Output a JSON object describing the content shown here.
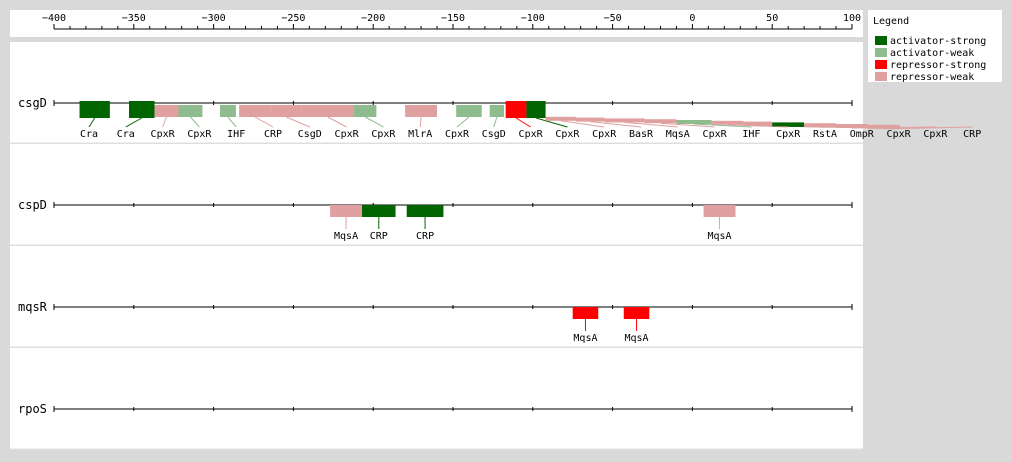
{
  "chart_data": {
    "type": "track-diagram",
    "axis": {
      "min": -400,
      "max": 100,
      "major_ticks": [
        -400,
        -350,
        -300,
        -250,
        -200,
        -150,
        -100,
        -50,
        0,
        50,
        100
      ],
      "tick_labels": [
        "−400",
        "−350",
        "−300",
        "−250",
        "−200",
        "−150",
        "−100",
        "−50",
        "0",
        "50",
        "100"
      ]
    },
    "legend": {
      "title": "Legend",
      "entries": [
        {
          "name": "activator-strong",
          "color": "#006400"
        },
        {
          "name": "activator-weak",
          "color": "#8fbc8f"
        },
        {
          "name": "repressor-strong",
          "color": "#ff0000"
        },
        {
          "name": "repressor-weak",
          "color": "#e0a0a0"
        }
      ]
    },
    "tracks": [
      {
        "gene": "csgD",
        "sites": [
          {
            "label": "Cra",
            "start": -384,
            "end": -365,
            "type": "activator-strong"
          },
          {
            "label": "Cra",
            "start": -353,
            "end": -337,
            "type": "activator-strong"
          },
          {
            "label": "CpxR",
            "start": -337,
            "end": -322,
            "type": "repressor-weak"
          },
          {
            "label": "CpxR",
            "start": -322,
            "end": -307,
            "type": "activator-weak"
          },
          {
            "label": "IHF",
            "start": -296,
            "end": -286,
            "type": "activator-weak"
          },
          {
            "label": "CRP",
            "start": -284,
            "end": -264,
            "type": "repressor-weak"
          },
          {
            "label": "CsgD",
            "start": -264,
            "end": -245,
            "type": "repressor-weak"
          },
          {
            "label": "CpxR",
            "start": -245,
            "end": -212,
            "type": "repressor-weak"
          },
          {
            "label": "CpxR",
            "start": -212,
            "end": -198,
            "type": "activator-weak"
          },
          {
            "label": "MlrA",
            "start": -180,
            "end": -160,
            "type": "repressor-weak"
          },
          {
            "label": "CpxR",
            "start": -148,
            "end": -132,
            "type": "activator-weak"
          },
          {
            "label": "CsgD",
            "start": -127,
            "end": -118,
            "type": "activator-weak"
          },
          {
            "label": "CpxR",
            "start": -117,
            "end": -104,
            "type": "repressor-strong"
          },
          {
            "label": "CpxR",
            "start": -104,
            "end": -92,
            "type": "activator-strong"
          },
          {
            "label": "CpxR",
            "start": -92,
            "end": -73,
            "type": "repressor-weak"
          },
          {
            "label": "BasR",
            "start": -73,
            "end": -55,
            "type": "repressor-weak"
          },
          {
            "label": "MqsA",
            "start": -55,
            "end": -30,
            "type": "repressor-weak"
          },
          {
            "label": "CpxR",
            "start": -30,
            "end": -10,
            "type": "repressor-weak"
          },
          {
            "label": "IHF",
            "start": -10,
            "end": 12,
            "type": "activator-weak"
          },
          {
            "label": "CpxR",
            "start": 12,
            "end": 32,
            "type": "repressor-weak"
          },
          {
            "label": "RstA",
            "start": 32,
            "end": 50,
            "type": "repressor-weak"
          },
          {
            "label": "OmpR",
            "start": 50,
            "end": 70,
            "type": "activator-strong"
          },
          {
            "label": "CpxR",
            "start": 70,
            "end": 90,
            "type": "repressor-weak"
          },
          {
            "label": "CpxR",
            "start": 90,
            "end": 110,
            "type": "repressor-weak"
          },
          {
            "label": "CRP",
            "start": 110,
            "end": 130,
            "type": "repressor-weak"
          }
        ]
      },
      {
        "gene": "cspD",
        "sites": [
          {
            "label": "MqsA",
            "start": -227,
            "end": -207,
            "type": "repressor-weak"
          },
          {
            "label": "CRP",
            "start": -207,
            "end": -186,
            "type": "activator-strong"
          },
          {
            "label": "CRP",
            "start": -179,
            "end": -156,
            "type": "activator-strong"
          },
          {
            "label": "MqsA",
            "start": 7,
            "end": 27,
            "type": "repressor-weak"
          }
        ]
      },
      {
        "gene": "mqsR",
        "sites": [
          {
            "label": "MqsA",
            "start": -75,
            "end": -59,
            "type": "repressor-strong"
          },
          {
            "label": "MqsA",
            "start": -43,
            "end": -27,
            "type": "repressor-strong"
          }
        ]
      },
      {
        "gene": "rpoS",
        "sites": []
      }
    ]
  }
}
